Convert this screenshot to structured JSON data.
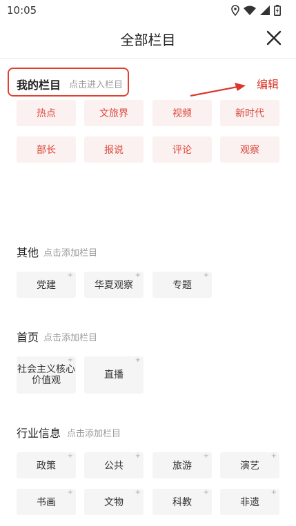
{
  "status": {
    "time": "10:05"
  },
  "header": {
    "title": "全部栏目"
  },
  "my_columns": {
    "title": "我的栏目",
    "hint": "点击进入栏目",
    "edit_label": "编辑",
    "items": [
      "热点",
      "文旅界",
      "视频",
      "新时代",
      "部长",
      "报说",
      "评论",
      "观察"
    ]
  },
  "sections": [
    {
      "title": "其他",
      "hint": "点击添加栏目",
      "items": [
        "党建",
        "华夏观察",
        "专题"
      ]
    },
    {
      "title": "首页",
      "hint": "点击添加栏目",
      "items": [
        "社会主义核心\n价值观",
        "直播"
      ]
    },
    {
      "title": "行业信息",
      "hint": "点击添加栏目",
      "items": [
        "政策",
        "公共",
        "旅游",
        "演艺",
        "书画",
        "文物",
        "科教",
        "非遗"
      ]
    }
  ],
  "colors": {
    "accent": "#d9392c",
    "chip_mine_bg": "#fcf1f1",
    "chip_other_bg": "#f5f5f5"
  }
}
